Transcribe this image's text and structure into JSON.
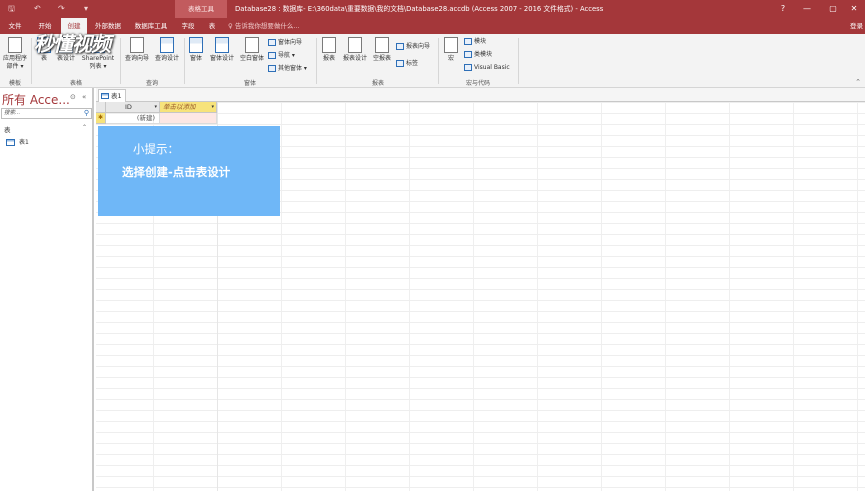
{
  "titlebar": {
    "qat_save": "🖫",
    "qat_undo": "↶",
    "qat_redo": "↷",
    "qat_more": "▾",
    "context_tab": "表格工具",
    "title": "Database28 : 数据库- E:\\360data\\重要数据\\我的文档\\Database28.accdb (Access 2007 - 2016 文件格式) - Access",
    "help": "?",
    "minimize": "—",
    "restore": "▢",
    "close": "✕"
  },
  "tabs": {
    "items": [
      "文件",
      "开始",
      "创建",
      "外部数据",
      "数据库工具",
      "字段",
      "表"
    ],
    "active_index": 2,
    "tell_me": "告诉我你想要做什么...",
    "user": "登录"
  },
  "ribbon": {
    "templates": {
      "app_parts": "应用程序\n部件 ▾",
      "label": "模板"
    },
    "tables": {
      "table": "表",
      "table_design": "表设计",
      "sharepoint": "SharePoint\n列表 ▾",
      "label": "表格"
    },
    "queries": {
      "wizard": "查询向导",
      "design": "查询设计",
      "label": "查询"
    },
    "forms": {
      "form": "窗体",
      "form_design": "窗体设计",
      "blank_form": "空白窗体",
      "form_wizard": "窗体向导",
      "navigation": "导航 ▾",
      "more_forms": "其他窗体 ▾",
      "label": "窗体"
    },
    "reports": {
      "report": "报表",
      "report_design": "报表设计",
      "blank_report": "空报表",
      "report_wizard": "报表向导",
      "labels": "标签",
      "label": "报表"
    },
    "macros": {
      "macro": "宏",
      "module": "模块",
      "class_module": "类模块",
      "visual_basic": "Visual Basic",
      "label": "宏与代码"
    },
    "watermark": "秒懂视频"
  },
  "nav": {
    "title": "所有 Acce...",
    "search_placeholder": "搜索...",
    "group": "表",
    "items": [
      {
        "label": "表1"
      }
    ]
  },
  "document": {
    "tab_label": "表1"
  },
  "sheet": {
    "columns": [
      {
        "label": "ID"
      },
      {
        "label": "单击以添加"
      }
    ],
    "new_record": "(新建)",
    "new_row_marker": "✱"
  },
  "tip": {
    "line1": "小提示：",
    "line2": "选择创建-点击表设计"
  }
}
